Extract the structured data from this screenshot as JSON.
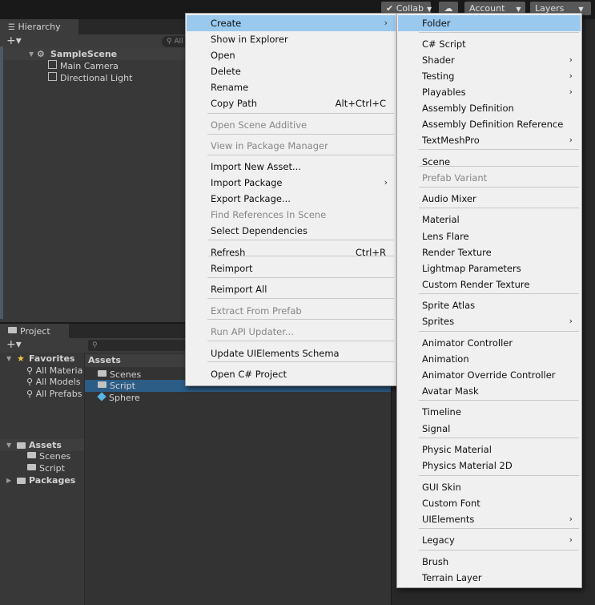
{
  "toolbar": {
    "collab": "Collab",
    "account": "Account",
    "layers": "Layers"
  },
  "hierarchy": {
    "tab": "Hierarchy",
    "search_placeholder": "All",
    "scene": "SampleScene",
    "items": [
      "Main Camera",
      "Directional Light"
    ]
  },
  "project": {
    "tab": "Project",
    "favorites": "Favorites",
    "favorite_items": [
      "All Materia",
      "All Models",
      "All Prefabs"
    ],
    "assets": "Assets",
    "asset_children": [
      "Scenes",
      "Script"
    ],
    "packages": "Packages",
    "content_header": "Assets",
    "content_items": [
      "Scenes",
      "Script",
      "Sphere"
    ]
  },
  "context_menu": {
    "items": [
      {
        "label": "Create",
        "submenu": true,
        "highlighted": true
      },
      {
        "label": "Show in Explorer"
      },
      {
        "label": "Open"
      },
      {
        "label": "Delete"
      },
      {
        "label": "Rename"
      },
      {
        "label": "Copy Path",
        "shortcut": "Alt+Ctrl+C"
      },
      {
        "label": "Open Scene Additive",
        "disabled": true
      },
      {
        "label": "View in Package Manager",
        "disabled": true
      },
      {
        "label": "Import New Asset..."
      },
      {
        "label": "Import Package",
        "submenu": true
      },
      {
        "label": "Export Package..."
      },
      {
        "label": "Find References In Scene",
        "disabled": true
      },
      {
        "label": "Select Dependencies"
      },
      {
        "label": "Refresh",
        "shortcut": "Ctrl+R"
      },
      {
        "label": "Reimport"
      },
      {
        "label": "Reimport All"
      },
      {
        "label": "Extract From Prefab",
        "disabled": true
      },
      {
        "label": "Run API Updater...",
        "disabled": true
      },
      {
        "label": "Update UIElements Schema"
      },
      {
        "label": "Open C# Project"
      }
    ]
  },
  "create_submenu": {
    "items": [
      {
        "label": "Folder",
        "highlighted": true
      },
      {
        "label": "C# Script"
      },
      {
        "label": "Shader",
        "submenu": true
      },
      {
        "label": "Testing",
        "submenu": true
      },
      {
        "label": "Playables",
        "submenu": true
      },
      {
        "label": "Assembly Definition"
      },
      {
        "label": "Assembly Definition Reference"
      },
      {
        "label": "TextMeshPro",
        "submenu": true
      },
      {
        "label": "Scene"
      },
      {
        "label": "Prefab Variant",
        "disabled": true
      },
      {
        "label": "Audio Mixer"
      },
      {
        "label": "Material"
      },
      {
        "label": "Lens Flare"
      },
      {
        "label": "Render Texture"
      },
      {
        "label": "Lightmap Parameters"
      },
      {
        "label": "Custom Render Texture"
      },
      {
        "label": "Sprite Atlas"
      },
      {
        "label": "Sprites",
        "submenu": true
      },
      {
        "label": "Animator Controller"
      },
      {
        "label": "Animation"
      },
      {
        "label": "Animator Override Controller"
      },
      {
        "label": "Avatar Mask"
      },
      {
        "label": "Timeline"
      },
      {
        "label": "Signal"
      },
      {
        "label": "Physic Material"
      },
      {
        "label": "Physics Material 2D"
      },
      {
        "label": "GUI Skin"
      },
      {
        "label": "Custom Font"
      },
      {
        "label": "UIElements",
        "submenu": true
      },
      {
        "label": "Legacy",
        "submenu": true
      },
      {
        "label": "Brush"
      },
      {
        "label": "Terrain Layer"
      }
    ]
  },
  "colors": {
    "highlight": "#99c9ef",
    "selection": "#2c5d87",
    "menu_bg": "#f0f0f0",
    "panel_bg": "#383838"
  }
}
